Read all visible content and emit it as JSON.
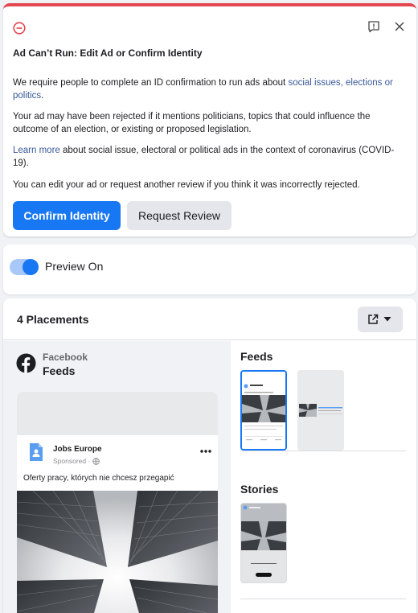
{
  "alert": {
    "title": "Ad Can’t Run: Edit Ad or Confirm Identity",
    "p1_text": "We require people to complete an ID confirmation to run ads about ",
    "p1_link": "social issues, elections or politics",
    "p1_end": ".",
    "p2": "Your ad may have been rejected if it mentions politicians, topics that could influence the outcome of an election, or existing or proposed legislation.",
    "p3_link": "Learn more",
    "p3_text": " about social issue, electoral or political ads in the context of coronavirus (COVID-19).",
    "p4": "You can edit your ad or request another review if you think it was incorrectly rejected.",
    "confirm_label": "Confirm Identity",
    "review_label": "Request Review",
    "accent_color": "#e4474f"
  },
  "preview": {
    "toggle_label": "Preview On",
    "toggle_on": true
  },
  "placements": {
    "title": "4 Placements",
    "platform": "Facebook",
    "position": "Feeds",
    "post": {
      "page_name": "Jobs Europe",
      "sponsored": "Sponsored ·",
      "text": "Oferty pracy, których nie chcesz przegapić"
    },
    "sections": {
      "feeds_label": "Feeds",
      "stories_label": "Stories"
    }
  },
  "colors": {
    "primary": "#1877f2",
    "secondary_bg": "#e4e6eb",
    "link": "#385898"
  }
}
